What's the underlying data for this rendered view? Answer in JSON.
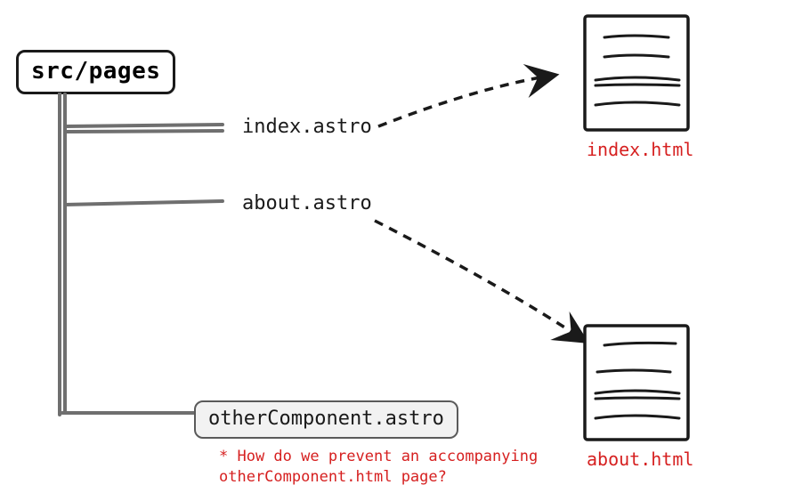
{
  "root": {
    "label": "src/pages"
  },
  "files": {
    "index": "index.astro",
    "about": "about.astro",
    "other": "otherComponent.astro"
  },
  "outputs": {
    "index": "index.html",
    "about": "about.html"
  },
  "note": "* How do we prevent an accompanying otherComponent.html page?"
}
